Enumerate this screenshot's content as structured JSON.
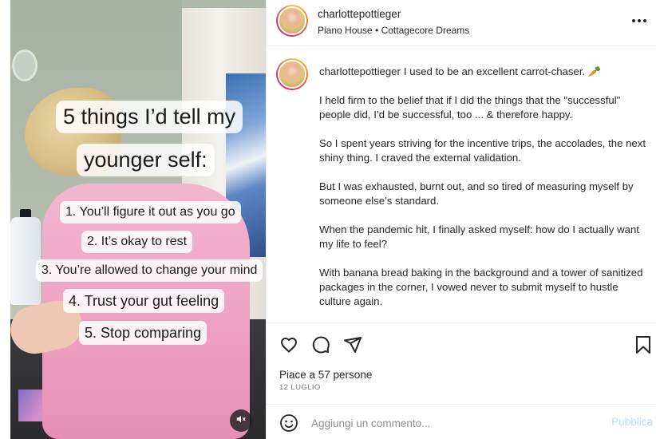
{
  "video": {
    "title_lines": [
      "5 things I’d tell my",
      "younger self:"
    ],
    "items": [
      "1. You’ll figure it out as you go",
      "2. It’s okay to rest",
      "3. You’re allowed to change your mind",
      "4. Trust your gut feeling",
      "5. Stop comparing"
    ],
    "mute_icon": "speaker-muted-icon"
  },
  "header": {
    "username": "charlottepottieger",
    "subtitle": "Piano House • Cottagecore Dreams",
    "more_icon": "more-options-icon"
  },
  "caption": {
    "username": "charlottepottieger",
    "paragraphs": [
      "I used to be an excellent carrot-chaser. 🥕",
      "I held firm to the belief that if I did the things that the \"successful\" people did, I’d be successful, too ... & therefore happy.",
      "So I spent years striving for the incentive trips, the accolades, the next shiny thing. I craved the external validation.",
      "But I was exhausted, burnt out, and so tired of measuring myself by someone else’s standard.",
      "When the pandemic hit, I finally asked myself: how do I actually want my life to feel?",
      "With banana bread baking in the background and a tower of sanitized packages in the corner, I vowed never to submit myself to hustle culture again."
    ]
  },
  "actions": {
    "icons": [
      "heart-icon",
      "comment-icon",
      "share-icon",
      "bookmark-icon"
    ]
  },
  "likes_text": "Piace a 57 persone",
  "date_text": "12 LUGLIO",
  "comment": {
    "placeholder": "Aggiungi un commento...",
    "publish_label": "Pubblica",
    "emoji_icon": "emoji-icon"
  },
  "colors": {
    "accent": "#0095f6",
    "publish_disabled": "#b2dffc",
    "text": "#262626",
    "muted": "#737373",
    "divider": "#efefef"
  }
}
